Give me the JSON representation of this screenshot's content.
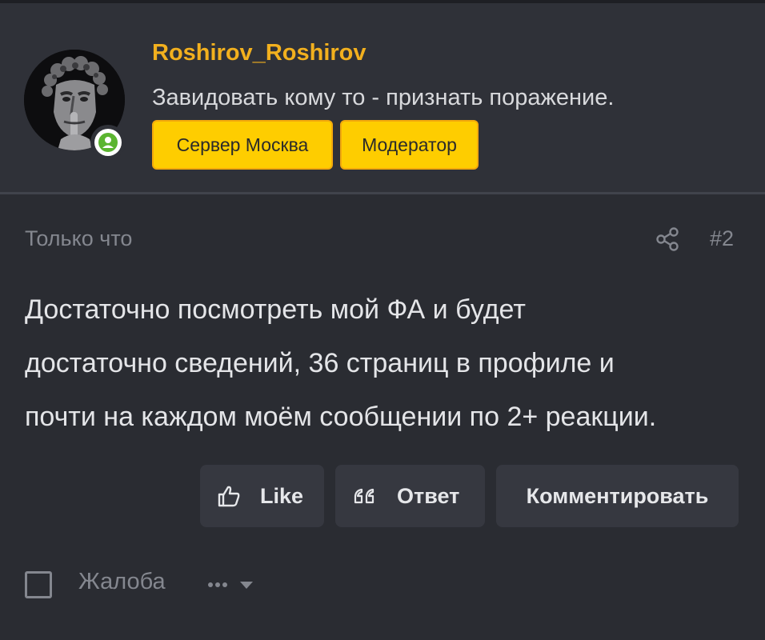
{
  "author": {
    "username": "Roshirov_Roshirov",
    "status": "Завидовать кому то - признать поражение.",
    "badges": [
      "Сервер Москва",
      "Модератор"
    ],
    "avatar_icon": "statue-portrait-icon",
    "online_icon": "user-online-icon",
    "username_color": "#f2b01e",
    "badge_color": "#fecd00"
  },
  "post": {
    "time": "Только что",
    "number": "#2",
    "body_lines": [
      "Достаточно посмотреть мой ФА и будет",
      "достаточно сведений, 36 страниц в профиле и",
      "почти на каждом моём сообщении по 2+ реакции."
    ]
  },
  "actions": {
    "like_label": "Like",
    "reply_label": "Ответ",
    "comment_label": "Комментировать"
  },
  "footer": {
    "report_label": "Жалоба",
    "more_icon": "more-dots-icon"
  }
}
